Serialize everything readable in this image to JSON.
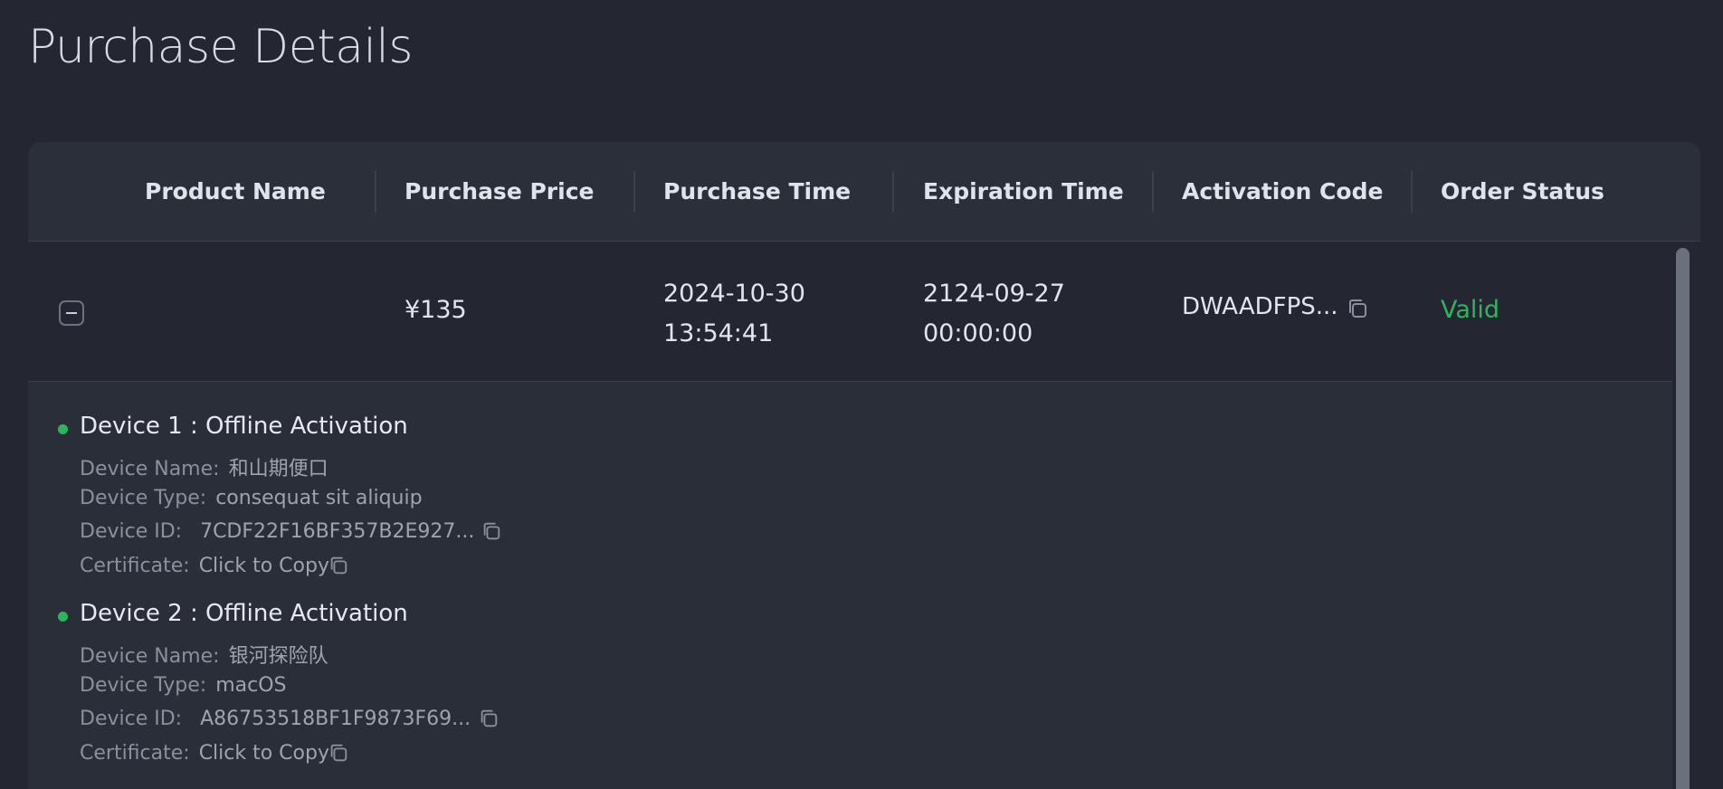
{
  "page": {
    "title": "Purchase Details"
  },
  "table": {
    "columns": [
      "Product Name",
      "Purchase Price",
      "Purchase Time",
      "Expiration Time",
      "Activation Code",
      "Order Status"
    ],
    "rows": [
      {
        "product_name": "",
        "purchase_price": "¥135",
        "purchase_date": "2024-10-30",
        "purchase_clock": "13:54:41",
        "expiration_date": "2124-09-27",
        "expiration_clock": "00:00:00",
        "activation_code": "DWAADFPS...",
        "order_status": "Valid",
        "status_color": "#2db55d",
        "devices": [
          {
            "title": "Device 1 : Offline Activation",
            "name_label": "Device Name:",
            "name_value": "和山期便口",
            "type_label": "Device Type:",
            "type_value": "consequat sit aliquip",
            "id_label": "Device ID:",
            "id_value": "7CDF22F16BF357B2E927...",
            "cert_label": "Certificate:",
            "cert_value": "Click to Copy"
          },
          {
            "title": "Device 2 : Offline Activation",
            "name_label": "Device Name:",
            "name_value": "银河探险队",
            "type_label": "Device Type:",
            "type_value": "macOS",
            "id_label": "Device ID:",
            "id_value": "A86753518BF1F9873F69...",
            "cert_label": "Certificate:",
            "cert_value": "Click to Copy"
          }
        ]
      }
    ]
  },
  "icons": {
    "copy": "copy-icon",
    "collapse": "minus-square-icon",
    "status_dot": "status-dot-icon"
  },
  "colors": {
    "background": "#242731",
    "accent_green": "#2db55d"
  }
}
